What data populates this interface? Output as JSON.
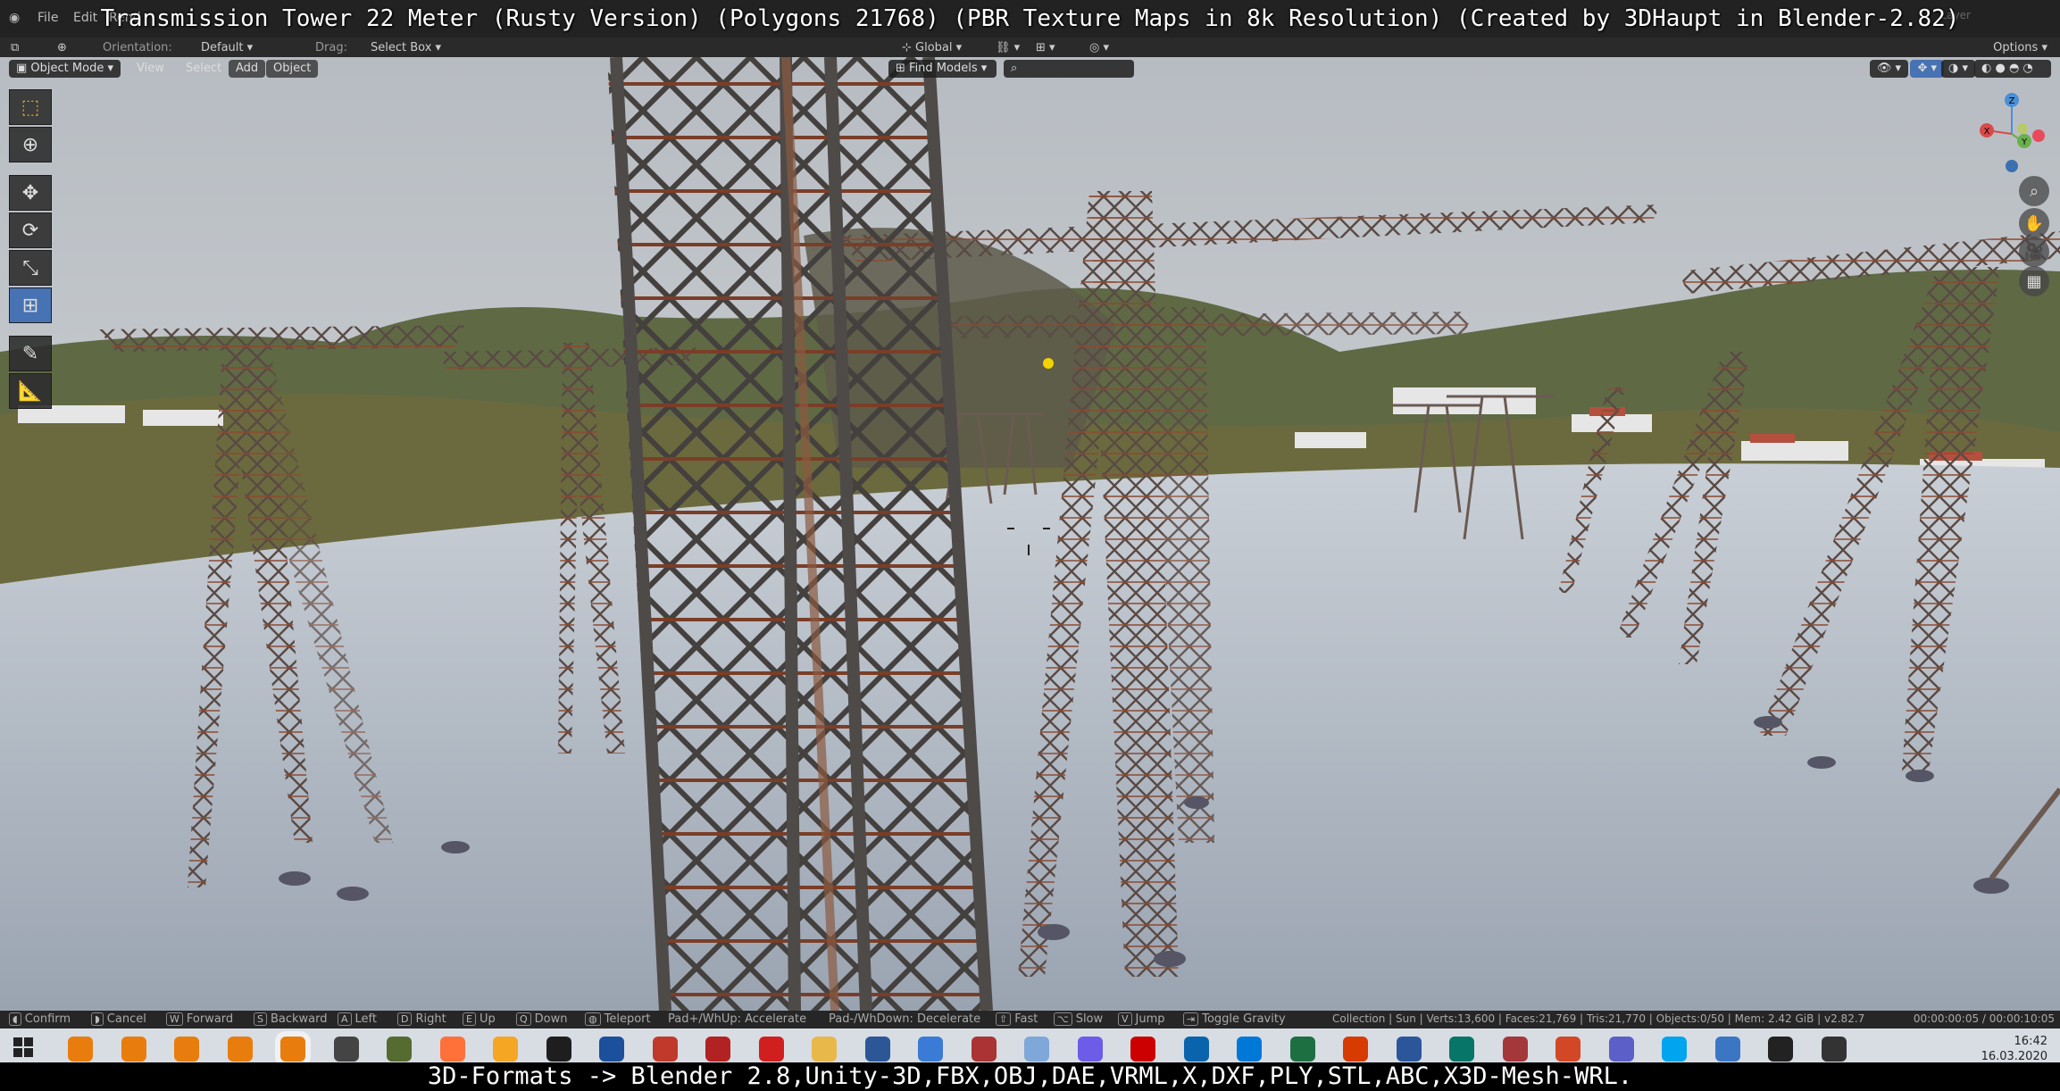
{
  "overlay": {
    "title": "Transmission Tower 22 Meter (Rusty Version) (Polygons 21768) (PBR Texture Maps in 8k Resolution) (Created by 3DHaupt in Blender-2.82)",
    "caption": "3D-Formats -> Blender 2.8,Unity-3D,FBX,OBJ,DAE,VRML,X,DXF,PLY,STL,ABC,X3D-Mesh-WRL."
  },
  "menubar": {
    "items": [
      "File",
      "Edit",
      "Rend"
    ],
    "right_label": "Layer"
  },
  "header": {
    "orientation_label": "Orientation:",
    "orientation_value": "Default",
    "drag_label": "Drag:",
    "drag_value": "Select Box",
    "transform_value": "Global",
    "options_label": "Options"
  },
  "viewport_header": {
    "mode": "Object Mode",
    "menus": [
      "View",
      "Select",
      "Add",
      "Object"
    ],
    "find_models": "Find Models",
    "search_placeholder": ""
  },
  "toolbar": {
    "tools": [
      {
        "name": "select-box",
        "glyph": "⬚",
        "active": false
      },
      {
        "name": "cursor",
        "glyph": "⊕",
        "active": false
      },
      {
        "name": "move",
        "glyph": "✥",
        "active": false
      },
      {
        "name": "rotate",
        "glyph": "⟳",
        "active": false
      },
      {
        "name": "scale",
        "glyph": "⤡",
        "active": false
      },
      {
        "name": "transform",
        "glyph": "⊞",
        "active": true
      },
      {
        "name": "annotate",
        "glyph": "✎",
        "active": false
      },
      {
        "name": "measure",
        "glyph": "📐",
        "active": false
      }
    ]
  },
  "gizmo": {
    "x_label": "X",
    "y_label": "Y",
    "z_label": "Z"
  },
  "statusbar": {
    "hints": [
      {
        "key": "",
        "label": "Confirm"
      },
      {
        "key": "",
        "label": "Cancel"
      },
      {
        "key": "W",
        "label": "Forward"
      },
      {
        "key": "S",
        "label": "Backward"
      },
      {
        "key": "A",
        "label": "Left"
      },
      {
        "key": "D",
        "label": "Right"
      },
      {
        "key": "E",
        "label": "Up"
      },
      {
        "key": "Q",
        "label": "Down"
      },
      {
        "key": "",
        "label": "Teleport"
      },
      {
        "key": "",
        "label": "Pad+/WhUp: Accelerate"
      },
      {
        "key": "",
        "label": "Pad-/WhDown: Decelerate"
      },
      {
        "key": "",
        "label": "Fast"
      },
      {
        "key": "",
        "label": "Slow"
      },
      {
        "key": "V",
        "label": "Jump"
      },
      {
        "key": "",
        "label": "Toggle Gravity"
      }
    ],
    "stats": "Collection | Sun | Verts:13,600 | Faces:21,769 | Tris:21,770 | Objects:0/50 | Mem: 2.42 GiB | v2.82.7",
    "timer": "00:00:00:05 / 00:00:10:05"
  },
  "taskbar": {
    "time": "16:42",
    "date": "16.03.2020",
    "icon_colors": [
      "#e87d0d",
      "#e87d0d",
      "#e87d0d",
      "#e87d0d",
      "#e87d0d",
      "#444444",
      "#556b2f",
      "#ff7139",
      "#f5a623",
      "#1e1e1e",
      "#1c4f9c",
      "#c0392b",
      "#b22222",
      "#d11f1f",
      "#e8b84a",
      "#2b5797",
      "#3a7bd5",
      "#aa3333",
      "#7fa7d9",
      "#6c5ce7",
      "#cc0000",
      "#0a64ad",
      "#0078d7",
      "#1d6f42",
      "#d83b01",
      "#2b579a",
      "#077568",
      "#a4373a",
      "#d24726",
      "#5b5fc7",
      "#00a4ef",
      "#3a76c4",
      "#222222",
      "#333333"
    ]
  }
}
